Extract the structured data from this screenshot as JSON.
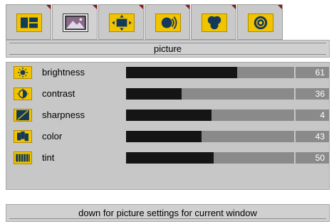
{
  "tabs": [
    {
      "icon": "layout-icon",
      "active": false
    },
    {
      "icon": "picture-icon",
      "active": true
    },
    {
      "icon": "screen-size-icon",
      "active": false
    },
    {
      "icon": "audio-icon",
      "active": false
    },
    {
      "icon": "color-icon",
      "active": false
    },
    {
      "icon": "source-icon",
      "active": false
    }
  ],
  "page": {
    "title": "picture"
  },
  "settings": [
    {
      "label": "brightness",
      "value": "61",
      "level": 0.66,
      "icon": "brightness-icon"
    },
    {
      "label": "contrast",
      "value": "36",
      "level": 0.33,
      "icon": "contrast-icon"
    },
    {
      "label": "sharpness",
      "value": "4",
      "level": 0.51,
      "icon": "sharpness-icon"
    },
    {
      "label": "color",
      "value": "43",
      "level": 0.45,
      "icon": "color-icon"
    },
    {
      "label": "tint",
      "value": "50",
      "level": 0.52,
      "icon": "tint-icon"
    }
  ],
  "help": {
    "text": "down for picture settings for current window"
  },
  "colors": {
    "accent": "#f2c400",
    "bar_fill": "#151515",
    "bar_track": "#8a8a8a",
    "panel": "#c7c7c7"
  }
}
